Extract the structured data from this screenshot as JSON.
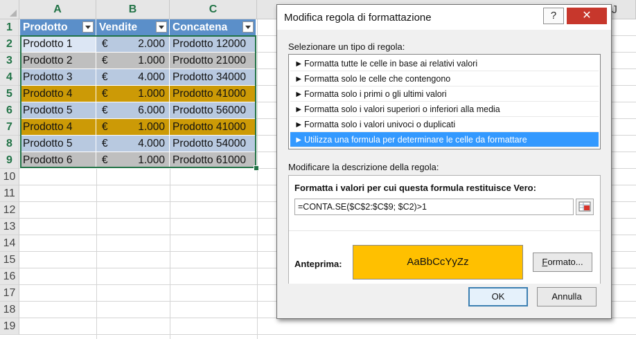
{
  "sheet": {
    "columns": [
      "A",
      "B",
      "C"
    ],
    "extra_column": "J",
    "rows": [
      "1",
      "2",
      "3",
      "4",
      "5",
      "6",
      "7",
      "8",
      "9",
      "10",
      "11",
      "12",
      "13",
      "14",
      "15",
      "16",
      "17",
      "18",
      "19"
    ],
    "headers": [
      "Prodotto",
      "Vendite",
      "Concatena"
    ],
    "data": [
      {
        "a": "Prodotto 1",
        "cur": "€",
        "b": "2.000",
        "c": "Prodotto 12000"
      },
      {
        "a": "Prodotto 2",
        "cur": "€",
        "b": "1.000",
        "c": "Prodotto 21000"
      },
      {
        "a": "Prodotto 3",
        "cur": "€",
        "b": "4.000",
        "c": "Prodotto 34000"
      },
      {
        "a": "Prodotto 4",
        "cur": "€",
        "b": "1.000",
        "c": "Prodotto 41000"
      },
      {
        "a": "Prodotto 5",
        "cur": "€",
        "b": "6.000",
        "c": "Prodotto 56000"
      },
      {
        "a": "Prodotto 4",
        "cur": "€",
        "b": "1.000",
        "c": "Prodotto 41000"
      },
      {
        "a": "Prodotto 5",
        "cur": "€",
        "b": "4.000",
        "c": "Prodotto 54000"
      },
      {
        "a": "Prodotto 6",
        "cur": "€",
        "b": "1.000",
        "c": "Prodotto 61000"
      }
    ],
    "colors": {
      "header": "#5b8fc9",
      "band_blue": "#b8c9e0",
      "band_grey": "#bfbfbf",
      "highlight": "#cc9a06",
      "selection_border": "#217346"
    }
  },
  "dialog": {
    "title": "Modifica regola di formattazione",
    "help_glyph": "?",
    "close_glyph": "✕",
    "select_type_label": "Selezionare un tipo di regola:",
    "rule_arrow": "►",
    "rule_types": [
      "Formatta tutte le celle in base ai relativi valori",
      "Formatta solo le celle che contengono",
      "Formatta solo i primi o gli ultimi valori",
      "Formatta solo i valori superiori o inferiori alla media",
      "Formatta solo i valori univoci o duplicati",
      "Utilizza una formula per determinare le celle da formattare"
    ],
    "selected_rule_index": 5,
    "edit_desc_label": "Modificare la descrizione della regola:",
    "formula_heading": "Formatta i valori per cui questa formula restituisce Vero:",
    "formula_value": "=CONTA.SE($C$2:$C$9; $C2)>1",
    "preview_label": "Anteprima:",
    "preview_text": "AaBbCcYyZz",
    "preview_color": "#ffc000",
    "format_button": "Formato...",
    "ok_button": "OK",
    "cancel_button": "Annulla"
  }
}
